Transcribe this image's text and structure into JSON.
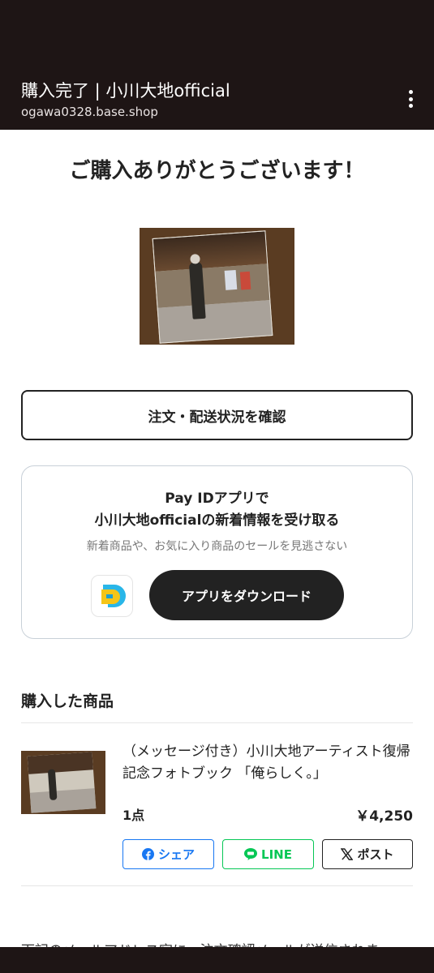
{
  "header": {
    "title": "購入完了 | 小川大地official",
    "domain": "ogawa0328.base.shop"
  },
  "thanks": "ご購入ありがとうございます！",
  "order_status_button": "注文・配送状況を確認",
  "payid": {
    "title_line1": "Pay IDアプリで",
    "title_line2": "小川大地officialの新着情報を受け取る",
    "subtitle": "新着商品や、お気に入り商品のセールを見逃さない",
    "download_button": "アプリをダウンロード"
  },
  "purchased": {
    "section_title": "購入した商品",
    "product_name": "（メッセージ付き）小川大地アーティスト復帰記念フォトブック 「俺らしく。」",
    "quantity": "1点",
    "price": "￥4,250"
  },
  "share": {
    "facebook": "シェア",
    "line": "LINE",
    "x": "ポスト"
  },
  "bottom_text": "下記のメールアドレス宛に、注文確認メールが送信されま",
  "colors": {
    "header_bg": "#1e1515",
    "facebook": "#1877f2",
    "line": "#06c755",
    "payid_yellow": "#f5c518",
    "payid_blue": "#29b6e8"
  }
}
